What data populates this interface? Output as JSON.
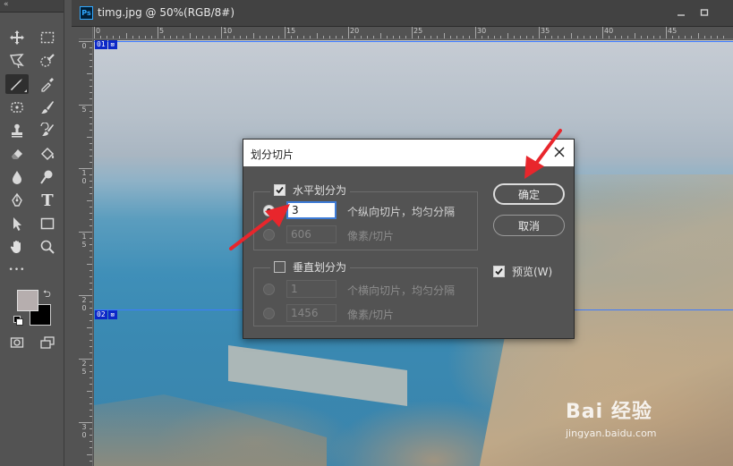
{
  "document": {
    "app_icon": "Ps",
    "tab_title": "timg.jpg @ 50%(RGB/8#)"
  },
  "toolbar": {
    "collapse_label": "«",
    "tools": [
      {
        "name": "move-tool",
        "icon": "move-icon"
      },
      {
        "name": "marquee-tool",
        "icon": "marquee-icon"
      },
      {
        "name": "lasso-tool",
        "icon": "lasso-icon"
      },
      {
        "name": "quick-select-tool",
        "icon": "quick-select-icon"
      },
      {
        "name": "slice-tool",
        "icon": "slice-icon"
      },
      {
        "name": "eyedropper-tool",
        "icon": "eyedropper-icon"
      },
      {
        "name": "healing-tool",
        "icon": "healing-icon"
      },
      {
        "name": "brush-tool",
        "icon": "brush-icon"
      },
      {
        "name": "stamp-tool",
        "icon": "stamp-icon"
      },
      {
        "name": "history-brush-tool",
        "icon": "history-brush-icon"
      },
      {
        "name": "eraser-tool",
        "icon": "eraser-icon"
      },
      {
        "name": "paint-bucket-tool",
        "icon": "paint-bucket-icon"
      },
      {
        "name": "blur-tool",
        "icon": "blur-icon"
      },
      {
        "name": "dodge-tool",
        "icon": "dodge-icon"
      },
      {
        "name": "pen-tool",
        "icon": "pen-icon"
      },
      {
        "name": "type-tool",
        "icon": "type-icon"
      },
      {
        "name": "path-select-tool",
        "icon": "path-select-icon"
      },
      {
        "name": "rectangle-tool",
        "icon": "rectangle-icon"
      },
      {
        "name": "hand-tool",
        "icon": "hand-icon"
      },
      {
        "name": "zoom-tool",
        "icon": "zoom-icon"
      }
    ],
    "type_glyph": "T",
    "more_glyph": "•••",
    "foreground_color": "#b6aeae",
    "background_color": "#000000"
  },
  "ruler": {
    "top_labels": [
      "0",
      "5",
      "10",
      "15",
      "20",
      "25",
      "30",
      "35",
      "40",
      "45"
    ],
    "left_labels": [
      {
        "text": "0"
      },
      {
        "text": "5"
      },
      {
        "text": "1\n0"
      },
      {
        "text": "1\n5"
      },
      {
        "text": "2\n0"
      },
      {
        "text": "2\n5"
      },
      {
        "text": "3\n0"
      }
    ]
  },
  "slices": [
    {
      "number": "01",
      "symbol": "⊠"
    },
    {
      "number": "02",
      "symbol": "⊠"
    }
  ],
  "dialog": {
    "title": "划分切片",
    "close_glyph": "✕",
    "horizontal": {
      "label": "水平划分为",
      "checked": true,
      "option_count_value": "3",
      "option_count_label": "个纵向切片，均匀分隔",
      "option_pixels_value": "606",
      "option_pixels_label": "像素/切片"
    },
    "vertical": {
      "label": "垂直划分为",
      "checked": false,
      "option_count_value": "1",
      "option_count_label": "个横向切片，均匀分隔",
      "option_pixels_value": "1456",
      "option_pixels_label": "像素/切片"
    },
    "ok_label": "确定",
    "cancel_label": "取消",
    "preview_label": "预览(W)",
    "preview_checked": true
  },
  "watermark": {
    "logo": "Bai  经验",
    "url": "jingyan.baidu.com"
  },
  "colors": {
    "annotation_arrow": "#e8262c",
    "slice_blue": "#0c28c8"
  }
}
